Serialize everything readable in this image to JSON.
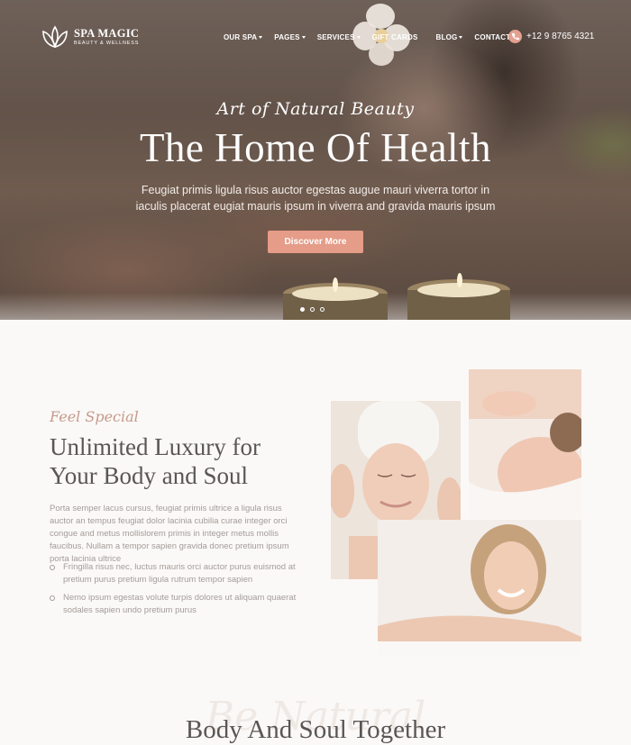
{
  "brand": {
    "name": "SPA MAGIC",
    "tagline": "BEAUTY & WELLNESS"
  },
  "nav": {
    "items": [
      {
        "label": "OUR SPA",
        "dropdown": true
      },
      {
        "label": "PAGES",
        "dropdown": true
      },
      {
        "label": "SERVICES",
        "dropdown": true
      },
      {
        "label": "GIFT CARDS",
        "dropdown": false
      },
      {
        "label": "BLOG",
        "dropdown": true
      },
      {
        "label": "CONTACTS",
        "dropdown": false
      }
    ],
    "phone": "+12 9 8765 4321"
  },
  "hero": {
    "subtitle": "Art of Natural Beauty",
    "title": "The Home Of Health",
    "description": "Feugiat primis ligula risus auctor egestas augue mauri viverra tortor in iaculis placerat eugiat mauris ipsum in viverra and gravida mauris ipsum",
    "cta": "Discover More",
    "slides": 3,
    "active_slide": 1
  },
  "about": {
    "kicker": "Feel Special",
    "title_line1": "Unlimited Luxury for",
    "title_line2": "Your Body and Soul",
    "description": "Porta semper lacus cursus, feugiat primis ultrice a ligula risus auctor an tempus feugiat dolor lacinia cubilia curae integer orci congue and metus mollislorem primis in integer metus mollis faucibus. Nullam a tempor sapien gravida donec pretium ipsum porta lacinia ultrice",
    "bullets": [
      "Fringilla risus nec, luctus mauris orci auctor purus euismod at pretium purus pretium ligula rutrum tempor sapien",
      "Nemo ipsum egestas volute turpis dolores ut aliquam quaerat sodales sapien undo pretium purus"
    ]
  },
  "together": {
    "watermark": "Be Natural",
    "title": "Body And Soul Together"
  },
  "colors": {
    "accent": "#e59c88",
    "heading": "#5a5655",
    "body": "#a29c99",
    "kicker": "#c59a8c"
  }
}
